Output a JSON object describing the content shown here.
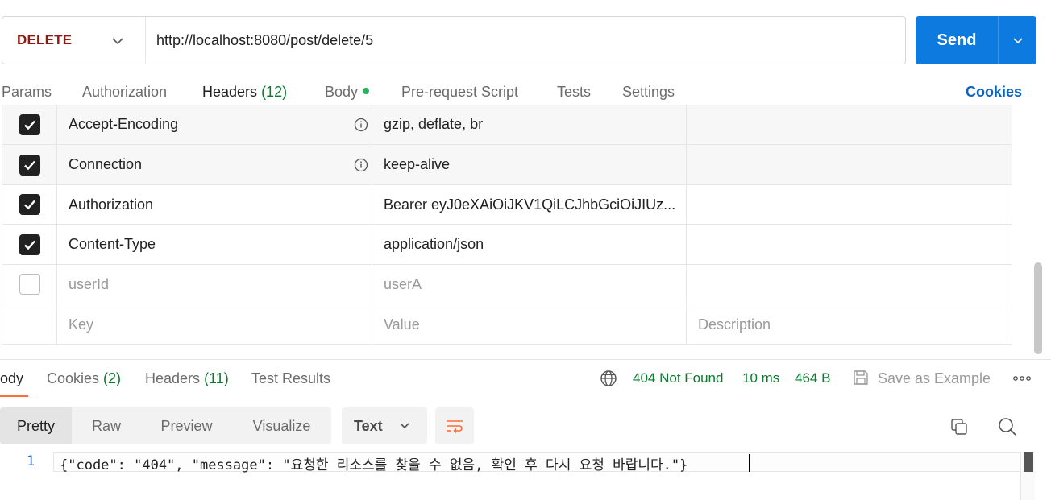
{
  "request": {
    "method": "DELETE",
    "url": "http://localhost:8080/post/delete/5",
    "send_label": "Send"
  },
  "request_tabs": [
    {
      "label": "Params"
    },
    {
      "label": "Authorization"
    },
    {
      "label": "Headers",
      "count": "(12)",
      "active": true
    },
    {
      "label": "Body",
      "has_dot": true
    },
    {
      "label": "Pre-request Script"
    },
    {
      "label": "Tests"
    },
    {
      "label": "Settings"
    }
  ],
  "cookies_link": "Cookies",
  "headers": [
    {
      "checked": true,
      "key": "Accept-Encoding",
      "value": "gzip, deflate, br",
      "info": true
    },
    {
      "checked": true,
      "key": "Connection",
      "value": "keep-alive",
      "info": true
    },
    {
      "checked": true,
      "key": "Authorization",
      "value": "Bearer eyJ0eXAiOiJKV1QiLCJhbGciOiJIUz..."
    },
    {
      "checked": true,
      "key": "Content-Type",
      "value": "application/json"
    },
    {
      "checked": false,
      "key": "userId",
      "value": "userA"
    }
  ],
  "new_row": {
    "key_placeholder": "Key",
    "value_placeholder": "Value",
    "description_placeholder": "Description"
  },
  "response_tabs": [
    {
      "label": "ody",
      "active": true
    },
    {
      "label": "Cookies",
      "count": "(2)"
    },
    {
      "label": "Headers",
      "count": "(11)"
    },
    {
      "label": "Test Results"
    }
  ],
  "response_status": {
    "status": "404 Not Found",
    "time": "10 ms",
    "size": "464 B",
    "save_example": "Save as Example"
  },
  "format_tabs": [
    "Pretty",
    "Raw",
    "Preview",
    "Visualize"
  ],
  "language": "Text",
  "code": {
    "line_number": "1",
    "content": "{\"code\": \"404\", \"message\": \"요청한 리소스를 찾을 수 없음, 확인 후 다시 요청 바랍니다.\"}"
  },
  "colors": {
    "accent": "#ff6c37",
    "send": "#0d7ae0",
    "method": "#8e1a10",
    "status_ok_text": "#0a7a2e",
    "link": "#0b62c4"
  }
}
